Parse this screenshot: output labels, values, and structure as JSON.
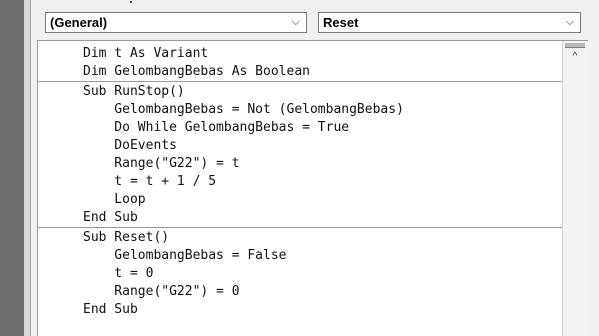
{
  "combos": {
    "object_value": "(General)",
    "procedure_value": "Reset",
    "dropdown_arrow": "⌵"
  },
  "code": {
    "lines": [
      "Dim t As Variant",
      "Dim GelombangBebas As Boolean",
      "Sub RunStop()",
      "    GelombangBebas = Not (GelombangBebas)",
      "    Do While GelombangBebas = True",
      "    DoEvents",
      "    Range(\"G22\") = t",
      "    t = t + 1 / 5",
      "    Loop",
      "End Sub",
      "Sub Reset()",
      "    GelombangBebas = False",
      "    t = 0",
      "    Range(\"G22\") = 0",
      "End Sub"
    ]
  },
  "scrollbar": {
    "up_arrow": "^"
  },
  "colors": {
    "rail": "#6e6e6e",
    "editor_bg": "#ffffff",
    "separator": "#9a9a9a"
  }
}
